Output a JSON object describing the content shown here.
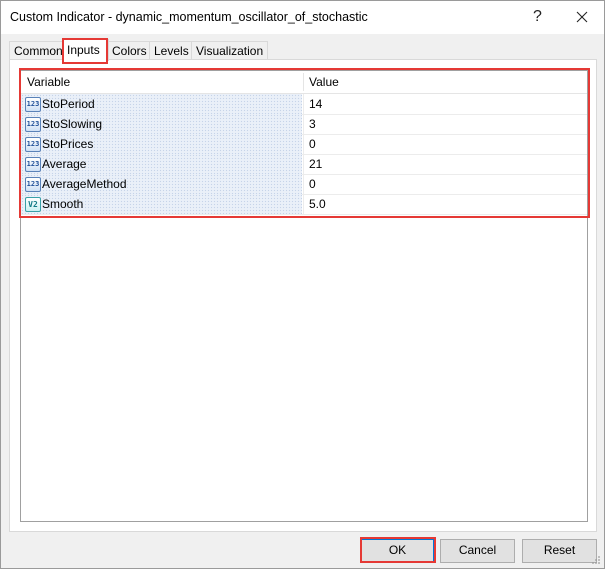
{
  "window": {
    "title": "Custom Indicator - dynamic_momentum_oscillator_of_stochastic",
    "help_label": "?",
    "close_icon": "close-icon"
  },
  "tabs": [
    {
      "label": "Common",
      "active": false
    },
    {
      "label": "Inputs",
      "active": true
    },
    {
      "label": "Colors",
      "active": false
    },
    {
      "label": "Levels",
      "active": false
    },
    {
      "label": "Visualization",
      "active": false
    }
  ],
  "grid": {
    "headers": {
      "variable": "Variable",
      "value": "Value"
    },
    "rows": [
      {
        "name": "StoPeriod",
        "value": "14",
        "icon": "integer-icon",
        "icon_text": "123"
      },
      {
        "name": "StoSlowing",
        "value": "3",
        "icon": "integer-icon",
        "icon_text": "123"
      },
      {
        "name": "StoPrices",
        "value": "0",
        "icon": "integer-icon",
        "icon_text": "123"
      },
      {
        "name": "Average",
        "value": "21",
        "icon": "integer-icon",
        "icon_text": "123"
      },
      {
        "name": "AverageMethod",
        "value": "0",
        "icon": "integer-icon",
        "icon_text": "123"
      },
      {
        "name": "Smooth",
        "value": "5.0",
        "icon": "double-icon",
        "icon_text": "V2"
      }
    ]
  },
  "buttons": {
    "ok": "OK",
    "cancel": "Cancel",
    "reset": "Reset"
  },
  "colors": {
    "highlight": "#e53935",
    "accent": "#0078d7"
  }
}
